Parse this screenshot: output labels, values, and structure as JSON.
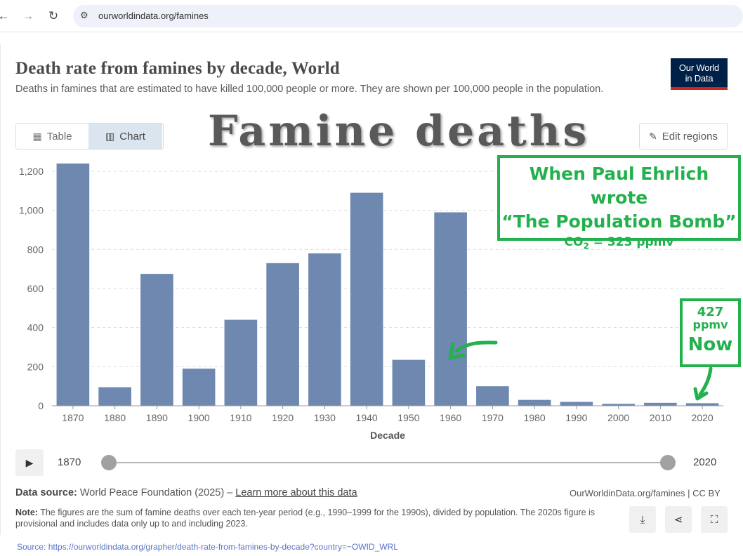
{
  "browser": {
    "url": "ourworldindata.org/famines",
    "back_icon": "arrow-left-icon",
    "forward_icon": "arrow-right-icon",
    "reload_icon": "reload-icon"
  },
  "header": {
    "title": "Death rate from famines by decade, World",
    "subtitle": "Deaths in famines that are estimated to have killed 100,000 people or more. They are shown per 100,000 people in the population.",
    "logo_line1": "Our World",
    "logo_line2": "in Data"
  },
  "tabs": {
    "table_label": "Table",
    "chart_label": "Chart"
  },
  "edit_regions_label": "Edit regions",
  "overlay": {
    "title": "Famine deaths",
    "ehrlich_line1": "When Paul Ehrlich wrote",
    "ehrlich_line2": "“The Population Bomb”",
    "ehrlich_co2": "CO",
    "ehrlich_co2_sub": "2",
    "ehrlich_co2_value": " = 323 ppmv",
    "now_value": "427",
    "now_unit": "ppmv",
    "now_label": "Now"
  },
  "colors": {
    "bar": "#6e88b0",
    "annotation": "#22b14c",
    "logo_bg": "#002147",
    "logo_accent": "#ce261e"
  },
  "chart_data": {
    "type": "bar",
    "categories": [
      "1870",
      "1880",
      "1890",
      "1900",
      "1910",
      "1920",
      "1930",
      "1940",
      "1950",
      "1960",
      "1970",
      "1980",
      "1990",
      "2000",
      "2010",
      "2020"
    ],
    "values": [
      1240,
      95,
      675,
      190,
      440,
      730,
      780,
      1090,
      235,
      990,
      100,
      30,
      20,
      10,
      15,
      13
    ],
    "xlabel": "Decade",
    "ylabel": "",
    "ylim": [
      0,
      1200
    ],
    "yticks": [
      0,
      200,
      400,
      600,
      800,
      1000,
      1200
    ],
    "ytick_labels": [
      "0",
      "200",
      "400",
      "600",
      "800",
      "1,000",
      "1,200"
    ],
    "grid": true
  },
  "timeline": {
    "start": "1870",
    "end": "2020"
  },
  "footer": {
    "source_label": "Data source:",
    "source_text": " World Peace Foundation (2025) – ",
    "learn_more": "Learn more about this data",
    "credit": "OurWorldinData.org/famines | CC BY",
    "note_label": "Note:",
    "note_text": " The figures are the sum of famine deaths over each ten-year period (e.g., 1990–1999 for the 1990s), divided by population. The 2020s figure is provisional and includes data only up to and including 2023.",
    "bottom_source": "Source:  https://ourworldindata.org/grapher/death-rate-from-famines-by-decade?country=~OWID_WRL"
  }
}
